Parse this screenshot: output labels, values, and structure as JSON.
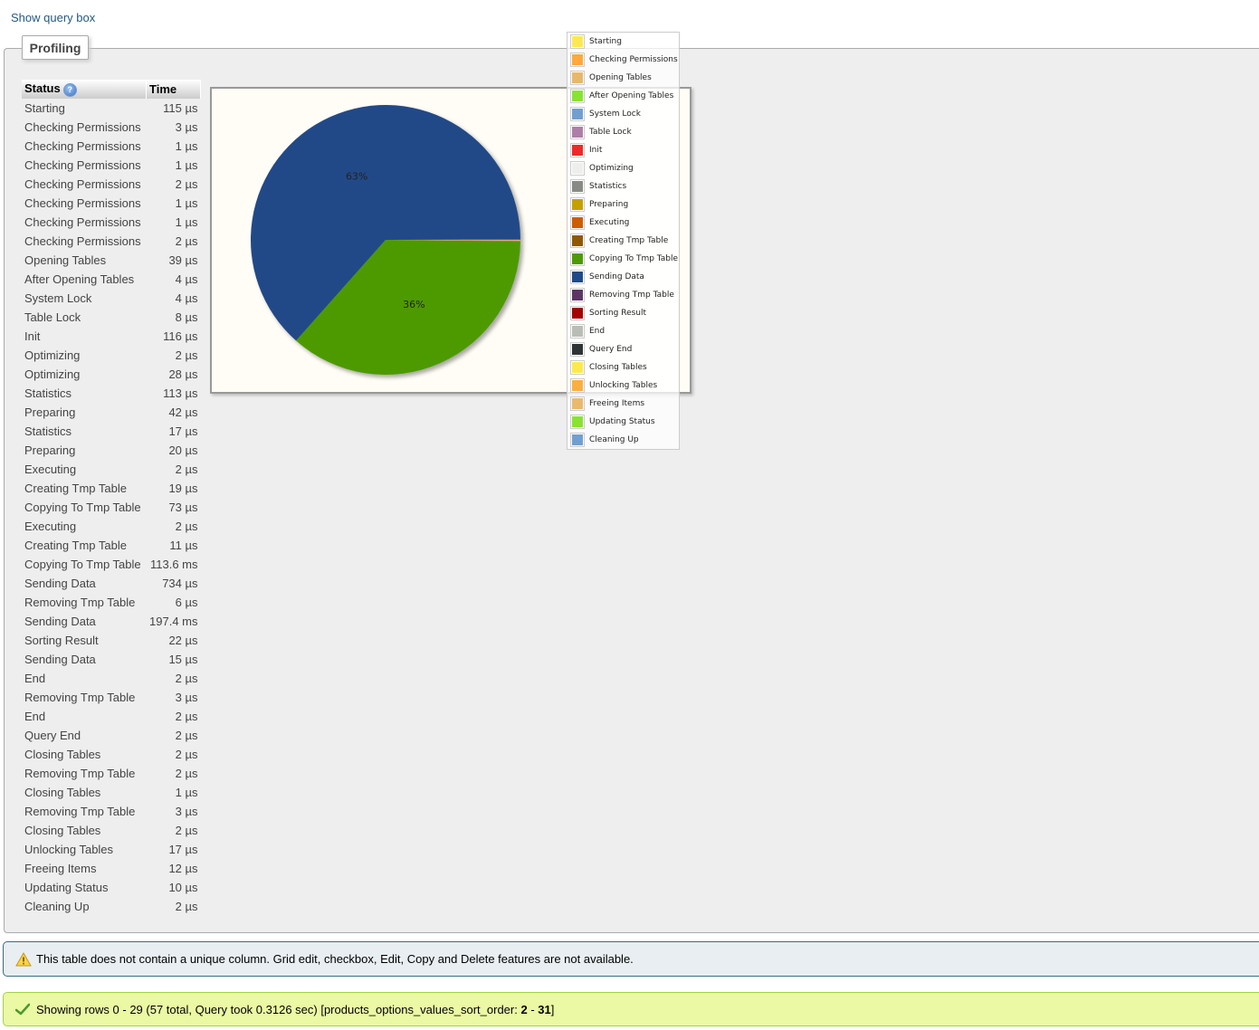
{
  "header": {
    "show_query_box": "Show query box"
  },
  "profiling": {
    "legend_title": "Profiling",
    "columns": {
      "status": "Status",
      "time": "Time"
    },
    "help_icon": "?",
    "rows": [
      {
        "status": "Starting",
        "time": "115 µs"
      },
      {
        "status": "Checking Permissions",
        "time": "3 µs"
      },
      {
        "status": "Checking Permissions",
        "time": "1 µs"
      },
      {
        "status": "Checking Permissions",
        "time": "1 µs"
      },
      {
        "status": "Checking Permissions",
        "time": "2 µs"
      },
      {
        "status": "Checking Permissions",
        "time": "1 µs"
      },
      {
        "status": "Checking Permissions",
        "time": "1 µs"
      },
      {
        "status": "Checking Permissions",
        "time": "2 µs"
      },
      {
        "status": "Opening Tables",
        "time": "39 µs"
      },
      {
        "status": "After Opening Tables",
        "time": "4 µs"
      },
      {
        "status": "System Lock",
        "time": "4 µs"
      },
      {
        "status": "Table Lock",
        "time": "8 µs"
      },
      {
        "status": "Init",
        "time": "116 µs"
      },
      {
        "status": "Optimizing",
        "time": "2 µs"
      },
      {
        "status": "Optimizing",
        "time": "28 µs"
      },
      {
        "status": "Statistics",
        "time": "113 µs"
      },
      {
        "status": "Preparing",
        "time": "42 µs"
      },
      {
        "status": "Statistics",
        "time": "17 µs"
      },
      {
        "status": "Preparing",
        "time": "20 µs"
      },
      {
        "status": "Executing",
        "time": "2 µs"
      },
      {
        "status": "Creating Tmp Table",
        "time": "19 µs"
      },
      {
        "status": "Copying To Tmp Table",
        "time": "73 µs"
      },
      {
        "status": "Executing",
        "time": "2 µs"
      },
      {
        "status": "Creating Tmp Table",
        "time": "11 µs"
      },
      {
        "status": "Copying To Tmp Table",
        "time": "113.6 ms"
      },
      {
        "status": "Sending Data",
        "time": "734 µs"
      },
      {
        "status": "Removing Tmp Table",
        "time": "6 µs"
      },
      {
        "status": "Sending Data",
        "time": "197.4 ms"
      },
      {
        "status": "Sorting Result",
        "time": "22 µs"
      },
      {
        "status": "Sending Data",
        "time": "15 µs"
      },
      {
        "status": "End",
        "time": "2 µs"
      },
      {
        "status": "Removing Tmp Table",
        "time": "3 µs"
      },
      {
        "status": "End",
        "time": "2 µs"
      },
      {
        "status": "Query End",
        "time": "2 µs"
      },
      {
        "status": "Closing Tables",
        "time": "2 µs"
      },
      {
        "status": "Removing Tmp Table",
        "time": "2 µs"
      },
      {
        "status": "Closing Tables",
        "time": "1 µs"
      },
      {
        "status": "Removing Tmp Table",
        "time": "3 µs"
      },
      {
        "status": "Closing Tables",
        "time": "2 µs"
      },
      {
        "status": "Unlocking Tables",
        "time": "17 µs"
      },
      {
        "status": "Freeing Items",
        "time": "12 µs"
      },
      {
        "status": "Updating Status",
        "time": "10 µs"
      },
      {
        "status": "Cleaning Up",
        "time": "2 µs"
      }
    ]
  },
  "chart_data": {
    "type": "pie",
    "title": "",
    "unit": "µs",
    "legend_position": "top-right",
    "start_angle_deg": 0,
    "direction": "clockwise",
    "slices": [
      {
        "label": "Starting",
        "value": 115,
        "color": "#fde84f"
      },
      {
        "label": "Checking Permissions",
        "value": 11,
        "color": "#ffa83c"
      },
      {
        "label": "Opening Tables",
        "value": 39,
        "color": "#e8b86a"
      },
      {
        "label": "After Opening Tables",
        "value": 4,
        "color": "#8ae234"
      },
      {
        "label": "System Lock",
        "value": 4,
        "color": "#729fcf"
      },
      {
        "label": "Table Lock",
        "value": 8,
        "color": "#ad7fa8"
      },
      {
        "label": "Init",
        "value": 116,
        "color": "#ef2929"
      },
      {
        "label": "Optimizing",
        "value": 30,
        "color": "#eeeeec"
      },
      {
        "label": "Statistics",
        "value": 130,
        "color": "#888a85"
      },
      {
        "label": "Preparing",
        "value": 62,
        "color": "#c4a000"
      },
      {
        "label": "Executing",
        "value": 4,
        "color": "#ce5c00"
      },
      {
        "label": "Creating Tmp Table",
        "value": 30,
        "color": "#8f5902"
      },
      {
        "label": "Copying To Tmp Table",
        "value": 113673,
        "color": "#4e9a06",
        "data_label": "36%"
      },
      {
        "label": "Sending Data",
        "value": 198149,
        "color": "#204a87",
        "data_label": "63%"
      },
      {
        "label": "Removing Tmp Table",
        "value": 14,
        "color": "#5c3566"
      },
      {
        "label": "Sorting Result",
        "value": 22,
        "color": "#a40000"
      },
      {
        "label": "End",
        "value": 4,
        "color": "#babdb6"
      },
      {
        "label": "Query End",
        "value": 2,
        "color": "#2e3436"
      },
      {
        "label": "Closing Tables",
        "value": 5,
        "color": "#fce94f"
      },
      {
        "label": "Unlocking Tables",
        "value": 17,
        "color": "#fcaf3e"
      },
      {
        "label": "Freeing Items",
        "value": 12,
        "color": "#e9b96e"
      },
      {
        "label": "Updating Status",
        "value": 10,
        "color": "#8ae234"
      },
      {
        "label": "Cleaning Up",
        "value": 2,
        "color": "#729fcf"
      }
    ]
  },
  "messages": {
    "notice": "This table does not contain a unique column. Grid edit, checkbox, Edit, Copy and Delete features are not available.",
    "success_prefix": "Showing rows 0 - 29 (57 total, Query took 0.3126 sec) [products_options_values_sort_order: ",
    "success_range_start": "2",
    "success_sep": " - ",
    "success_range_end": "31",
    "success_suffix": "]"
  }
}
